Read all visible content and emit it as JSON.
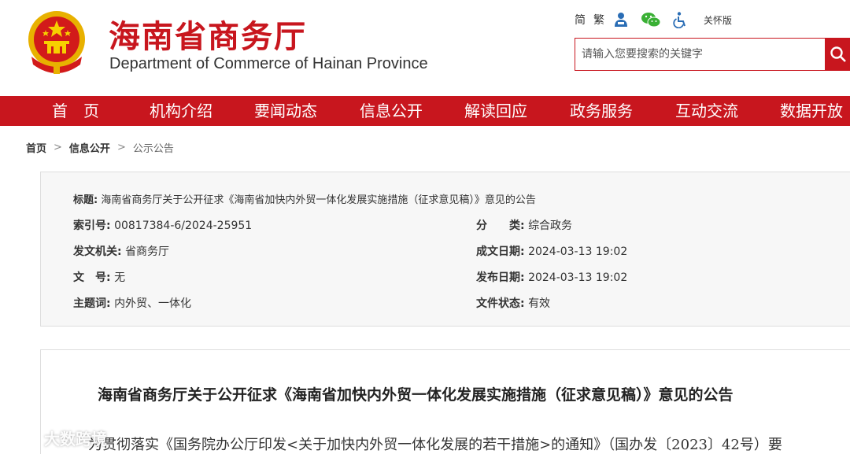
{
  "header": {
    "site_title": "海南省商务厅",
    "site_subtitle": "Department of Commerce of Hainan Province",
    "emblem_icon": "national-emblem-icon",
    "util": {
      "simplified": "简",
      "traditional": "繁",
      "care_mode": "关怀版",
      "icons": [
        "weibo-user-icon",
        "wechat-icon",
        "accessibility-icon"
      ]
    },
    "search": {
      "placeholder": "请输入您要搜索的关键字",
      "button_icon": "search-icon"
    }
  },
  "nav": {
    "items": [
      "首　页",
      "机构介绍",
      "要闻动态",
      "信息公开",
      "解读回应",
      "政务服务",
      "互动交流",
      "数据开放"
    ]
  },
  "breadcrumb": {
    "items": [
      "首页",
      "信息公开",
      "公示公告"
    ],
    "separator": ">"
  },
  "meta": {
    "title_label": "标题:",
    "title_value": "海南省商务厅关于公开征求《海南省加快内外贸一体化发展实施措施（征求意见稿）》意见的公告",
    "index_label": "索引号:",
    "index_value": "00817384-6/2024-25951",
    "category_label": "分　　类:",
    "category_value": "综合政务",
    "issuer_label": "发文机关:",
    "issuer_value": "省商务厅",
    "created_label": "成文日期:",
    "created_value": "2024-03-13 19:02",
    "docno_label": "文　号:",
    "docno_value": "无",
    "published_label": "发布日期:",
    "published_value": "2024-03-13 19:02",
    "subject_label": "主题词:",
    "subject_value": "内外贸、一体化",
    "status_label": "文件状态:",
    "status_value": "有效"
  },
  "content": {
    "doc_title": "海南省商务厅关于公开征求《海南省加快内外贸一体化发展实施措施（征求意见稿）》意见的公告",
    "body_line": "为贯彻落实《国务院办公厅印发<关于加快内外贸一体化发展的若干措施>的通知》（国办发〔2023〕42号）要"
  },
  "watermark": {
    "text": "大数跨境",
    "icon": "watermark-logo-icon"
  },
  "colors": {
    "brand_red": "#c8161e",
    "meta_bg": "#f7f7f7"
  }
}
